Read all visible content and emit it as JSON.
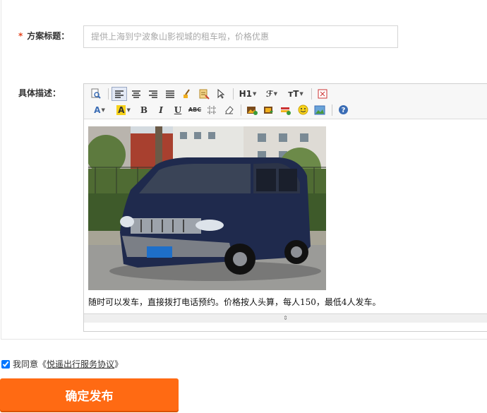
{
  "form": {
    "title_label": "方案标题：",
    "required_mark": "*",
    "title_placeholder": "提供上海到宁波象山影视城的租车啦，价格优惠",
    "desc_label": "具体描述："
  },
  "editor": {
    "toolbar": {
      "heading_label": "H1",
      "font_family_label": "ℱ",
      "font_size_label": "тT",
      "font_color_label": "A",
      "bg_color_label": "A",
      "bold_label": "B",
      "italic_label": "I",
      "underline_label": "U",
      "strike_label": "ABC"
    },
    "content_text": "随时可以发车，直接拨打电话预约。价格按人头算，每人150，最低4人发车。"
  },
  "agreement": {
    "checked": true,
    "prefix": "我同意《",
    "link_text": "悦遥出行服务协议",
    "suffix": "》"
  },
  "submit_label": "确定发布",
  "colors": {
    "accent": "#ff6a13",
    "required": "#e5431d"
  }
}
